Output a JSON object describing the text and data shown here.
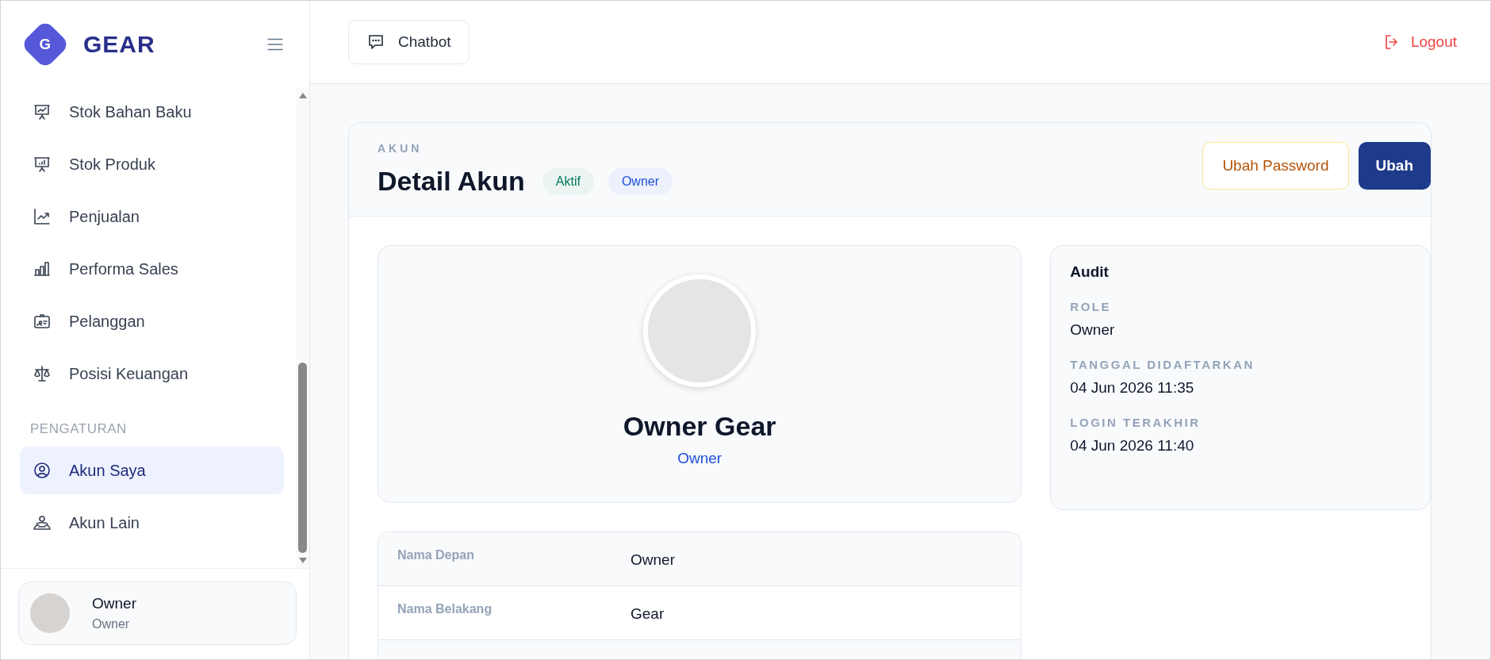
{
  "sidebar": {
    "brand": {
      "initial": "G",
      "name": "GEAR"
    },
    "items": [
      {
        "label": "Stok Bahan Baku",
        "selected": false
      },
      {
        "label": "Stok Produk",
        "selected": false
      },
      {
        "label": "Penjualan",
        "selected": false
      },
      {
        "label": "Performa Sales",
        "selected": false
      },
      {
        "label": "Pelanggan",
        "selected": false
      },
      {
        "label": "Posisi Keuangan",
        "selected": false
      }
    ],
    "section": {
      "title": "PENGATURAN",
      "items": [
        {
          "label": "Akun Saya",
          "selected": true
        },
        {
          "label": "Akun Lain",
          "selected": false
        }
      ]
    },
    "user": {
      "name": "Owner",
      "role": "Owner"
    }
  },
  "topbar": {
    "chatbot": "Chatbot",
    "logout": "Logout"
  },
  "card": {
    "eyebrow": "AKUN",
    "title": "Detail Akun",
    "badges": [
      {
        "label": "Aktif",
        "color": "#047857"
      },
      {
        "label": "Owner",
        "color": "#1d4ed8"
      }
    ],
    "buttons": [
      {
        "label": "Ubah Password",
        "kind": "outline"
      },
      {
        "label": "Ubah",
        "kind": "primary"
      }
    ],
    "profile": {
      "name": "Owner Gear",
      "role": "Owner"
    },
    "details": [
      {
        "label": "Nama Depan",
        "value": "Owner"
      },
      {
        "label": "Nama Belakang",
        "value": "Gear"
      }
    ],
    "audit": {
      "title": "Audit",
      "fields": [
        {
          "label": "ROLE",
          "value": "Owner"
        },
        {
          "label": "TANGGAL DIDAFTARKAN",
          "value": "04 Jun 2026 11:35"
        },
        {
          "label": "LOGIN TERAKHIR",
          "value": "04 Jun 2026 11:40"
        }
      ]
    }
  }
}
